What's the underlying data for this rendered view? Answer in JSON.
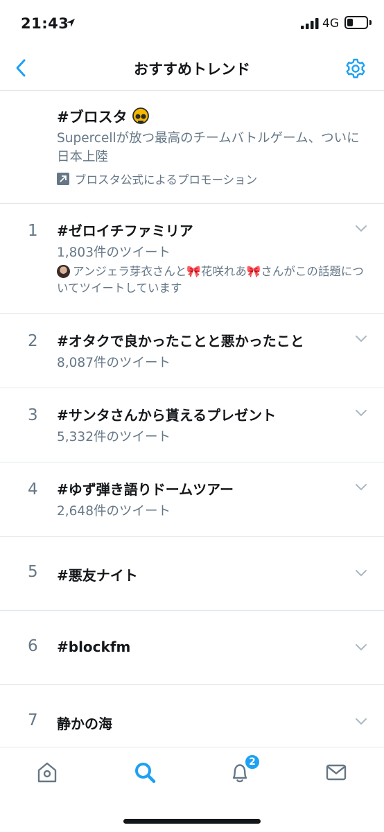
{
  "status_bar": {
    "time": "21:43",
    "network": "4G"
  },
  "header": {
    "title": "おすすめトレンド"
  },
  "promoted": {
    "tag": "#ブロスタ",
    "tag_emoji": "skull-emoji",
    "description": "Supercellが放つ最高のチームバトルゲーム、ついに日本上陸",
    "promoted_by": "ブロスタ公式によるプロモーション"
  },
  "trends": [
    {
      "rank": "1",
      "name": "#ゼロイチファミリア",
      "count": "1,803件のツイート",
      "context": "アンジェラ芽衣さんと🎀花咲れあ🎀さんがこの話題についてツイートしています"
    },
    {
      "rank": "2",
      "name": "#オタクで良かったことと悪かったこと",
      "count": "8,087件のツイート"
    },
    {
      "rank": "3",
      "name": "#サンタさんから貰えるプレゼント",
      "count": "5,332件のツイート"
    },
    {
      "rank": "4",
      "name": "#ゆず弾き語りドームツアー",
      "count": "2,648件のツイート"
    },
    {
      "rank": "5",
      "name": "#悪友ナイト"
    },
    {
      "rank": "6",
      "name": "#blockfm"
    },
    {
      "rank": "7",
      "name": "静かの海"
    }
  ],
  "tab_bar": {
    "items": [
      "home-icon",
      "search-icon",
      "notifications-icon",
      "messages-icon"
    ],
    "notifications_badge": "2"
  },
  "colors": {
    "accent": "#1da1f2",
    "text_primary": "#14171a",
    "text_secondary": "#657786",
    "divider": "#e1e8ed"
  }
}
